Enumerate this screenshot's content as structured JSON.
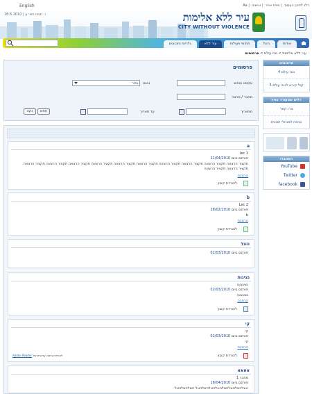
{
  "top": {
    "english": "English",
    "links": [
      "דלג לתוכן העמוד",
      "מפת אתר",
      "נגישות",
      "Aa"
    ],
    "date": "18.6.2010 | ו׳ תמוז תש״ע"
  },
  "header": {
    "logo_hebrew": "עיר ללא אלימות",
    "logo_english": "CITY WITHOUT VIOLENCE"
  },
  "nav": {
    "tabs": [
      "אודות",
      "הוגל",
      "תחומי פעילות",
      "עיר ללא",
      "גלריות ותכנונים"
    ],
    "active_index": 3
  },
  "breadcrumb": {
    "path": "עיר ללא אלימות > נוכי עילם > ",
    "current": "פרסומים"
  },
  "form": {
    "title": "פרסומים",
    "subject_label": "נושא",
    "subject_value": "בחר",
    "free_text_label": "טקסט חופשי",
    "author_label": "מחבר / מרצה",
    "from_date_label": "מתאריך",
    "to_date_label": "עד תאריך",
    "search_button": "חפש",
    "clear_button": "נקה"
  },
  "sidebar": {
    "publications_head": "פרסומים",
    "publications_items": [
      "נגה עילם 4",
      "קול קורא לנגה עילם 5"
    ],
    "more_head": "דלים שמעורר עניין",
    "more_items": [
      "צרו קשר",
      "כניסה למנהלי תוכנית"
    ],
    "follow_head": "התחברו",
    "social": [
      {
        "label": "YouTube",
        "color": "#d8332b"
      },
      {
        "label": "Twitter",
        "color": "#4aa8e0"
      },
      {
        "label": "facebook",
        "color": "#3b5998"
      }
    ]
  },
  "results": [
    {
      "title": "a",
      "subtitle": "lec 1",
      "date_label": "פורסם ביום",
      "date": "21/04/2010",
      "body": "תקציר הרצאה תקציר הרצאה תקציר הרצאה תקציר הרצאה תקציר הרצאה תקציר הרצאה תקציר הרצאה תקציר הרצאה תקציר הרצאה תקציר הרצאה תקציר הרצאה תקציר הרצאה",
      "more": "הרחבה",
      "download": "להורדת קובץ",
      "file_type": "doc"
    },
    {
      "title": "b",
      "subtitle": "Lec 2",
      "date_label": "פורסם ביום",
      "date": "28/02/2010",
      "body": "b",
      "more": "הרחבה",
      "download": "להורדת קובץ",
      "file_type": "doc"
    },
    {
      "title": "הוגל",
      "subtitle": "",
      "date_label": "פורסם ביום",
      "date": "02/03/2010",
      "body": "",
      "more": "",
      "download": "",
      "file_type": ""
    },
    {
      "title": "נציגות",
      "subtitle": "נציגציגנ",
      "date_label": "פורסם ביום",
      "date": "02/03/2010",
      "body": "נציגציגנ",
      "more": "הרחבה",
      "download": "להורדת קובץ",
      "file_type": "audio"
    },
    {
      "title": "קי",
      "subtitle": "קי",
      "date_label": "פורסם ביום",
      "date": "02/03/2010",
      "body": "קי",
      "more": "הרחבה",
      "download": "להורדת קובץ",
      "file_type": "pdf",
      "adobe_text": "להורדת גרסה עדכנית של",
      "adobe_link": "Adobe Reader"
    },
    {
      "title": "אאאא",
      "subtitle": "מחבר 1",
      "date_label": "פורסם ביום",
      "date": "18/04/2010",
      "body": "הוגלהוגלהוגלהוגלהוגלהוגלהוגלהוגל הוגלהוגלהוגל",
      "more": "",
      "download": "",
      "file_type": ""
    }
  ]
}
